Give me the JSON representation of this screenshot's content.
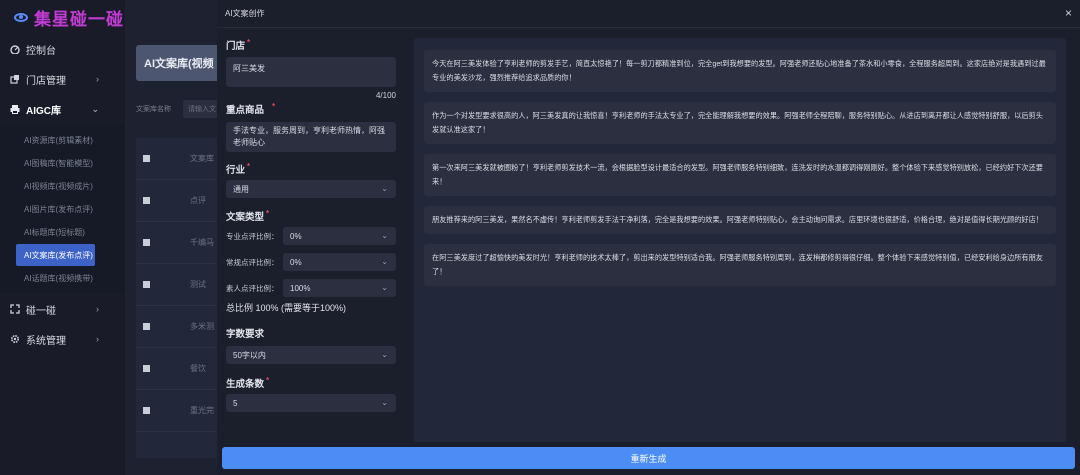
{
  "app": {
    "logo_text": "集星碰一碰"
  },
  "sidebar": {
    "items": [
      {
        "label": "控制台",
        "icon": "dashboard-icon"
      },
      {
        "label": "门店管理",
        "icon": "store-icon"
      },
      {
        "label": "AIGC库",
        "icon": "printer-icon"
      },
      {
        "label": "碰一碰",
        "icon": "expand-icon"
      },
      {
        "label": "系统管理",
        "icon": "gear-icon"
      }
    ],
    "aigc_children": [
      "AI资源库(剪辑素材)",
      "AI图稿库(智能模型)",
      "AI视频库(视频成片)",
      "AI图片库(发布点评)",
      "AI标题库(短标题)",
      "AI文案库(发布点评)",
      "AI话题库(视频携带)"
    ]
  },
  "background": {
    "page_title": "AI文案库(视频",
    "filter_label": "文案库名称",
    "filter_placeholder": "请输入文",
    "table_header": "文案库",
    "rows": [
      "点评",
      "千编马",
      "测试",
      "多米测",
      "餐饮",
      "重光完"
    ]
  },
  "drawer": {
    "title": "AI文案创作",
    "close": "×",
    "store": {
      "label": "门店",
      "value": "阿三美发",
      "count": "4/100"
    },
    "product": {
      "label": "重点商品",
      "value": "手法专业，服务周到，亨利老师热情，阿强老师贴心"
    },
    "industry": {
      "label": "行业",
      "value": "通用"
    },
    "copy_type": {
      "label": "文案类型",
      "rows": [
        {
          "label": "专业点评比例：",
          "value": "0%"
        },
        {
          "label": "常规点评比例：",
          "value": "0%"
        },
        {
          "label": "素人点评比例：",
          "value": "100%"
        }
      ],
      "total": "总比例 100% (需要等于100%)"
    },
    "word_limit": {
      "label": "字数要求",
      "value": "50字以内"
    },
    "gen_count": {
      "label": "生成条数",
      "value": "5"
    },
    "regen_button": "重新生成",
    "results": [
      "今天在阿三美发体验了亨利老师的剪发手艺，简直太惊艳了！每一剪刀都精准到位，完全get到我想要的发型。阿强老师还贴心地准备了茶水和小零食，全程服务超周到。这家店绝对是我遇到过最专业的美发沙龙，强烈推荐给追求品质的你！",
      "作为一个对发型要求很高的人，阿三美发真的让我惊喜！亨利老师的手法太专业了，完全能理解我想要的效果。阿强老师全程陪聊，服务特别贴心。从进店到离开都让人感觉特别舒服，以后剪头发就认准这家了！",
      "第一次来阿三美发就被圈粉了！亨利老师剪发技术一流，会根据脸型设计最适合的发型。阿强老师服务特别细致，连洗发时的水温都调得刚刚好。整个体验下来感觉特别放松，已经约好下次还要来！",
      "朋友推荐来的阿三美发，果然名不虚传！亨利老师剪发手法干净利落，完全是我想要的效果。阿强老师特别贴心，会主动询问需求。店里环境也很舒适，价格合理，绝对是值得长期光顾的好店！",
      "在阿三美发度过了超愉快的美发时光！亨利老师的技术太棒了，剪出来的发型特别适合我。阿强老师服务特别周到，连发梢都修剪得很仔细。整个体验下来感觉特别值，已经安利给身边所有朋友了！"
    ]
  }
}
